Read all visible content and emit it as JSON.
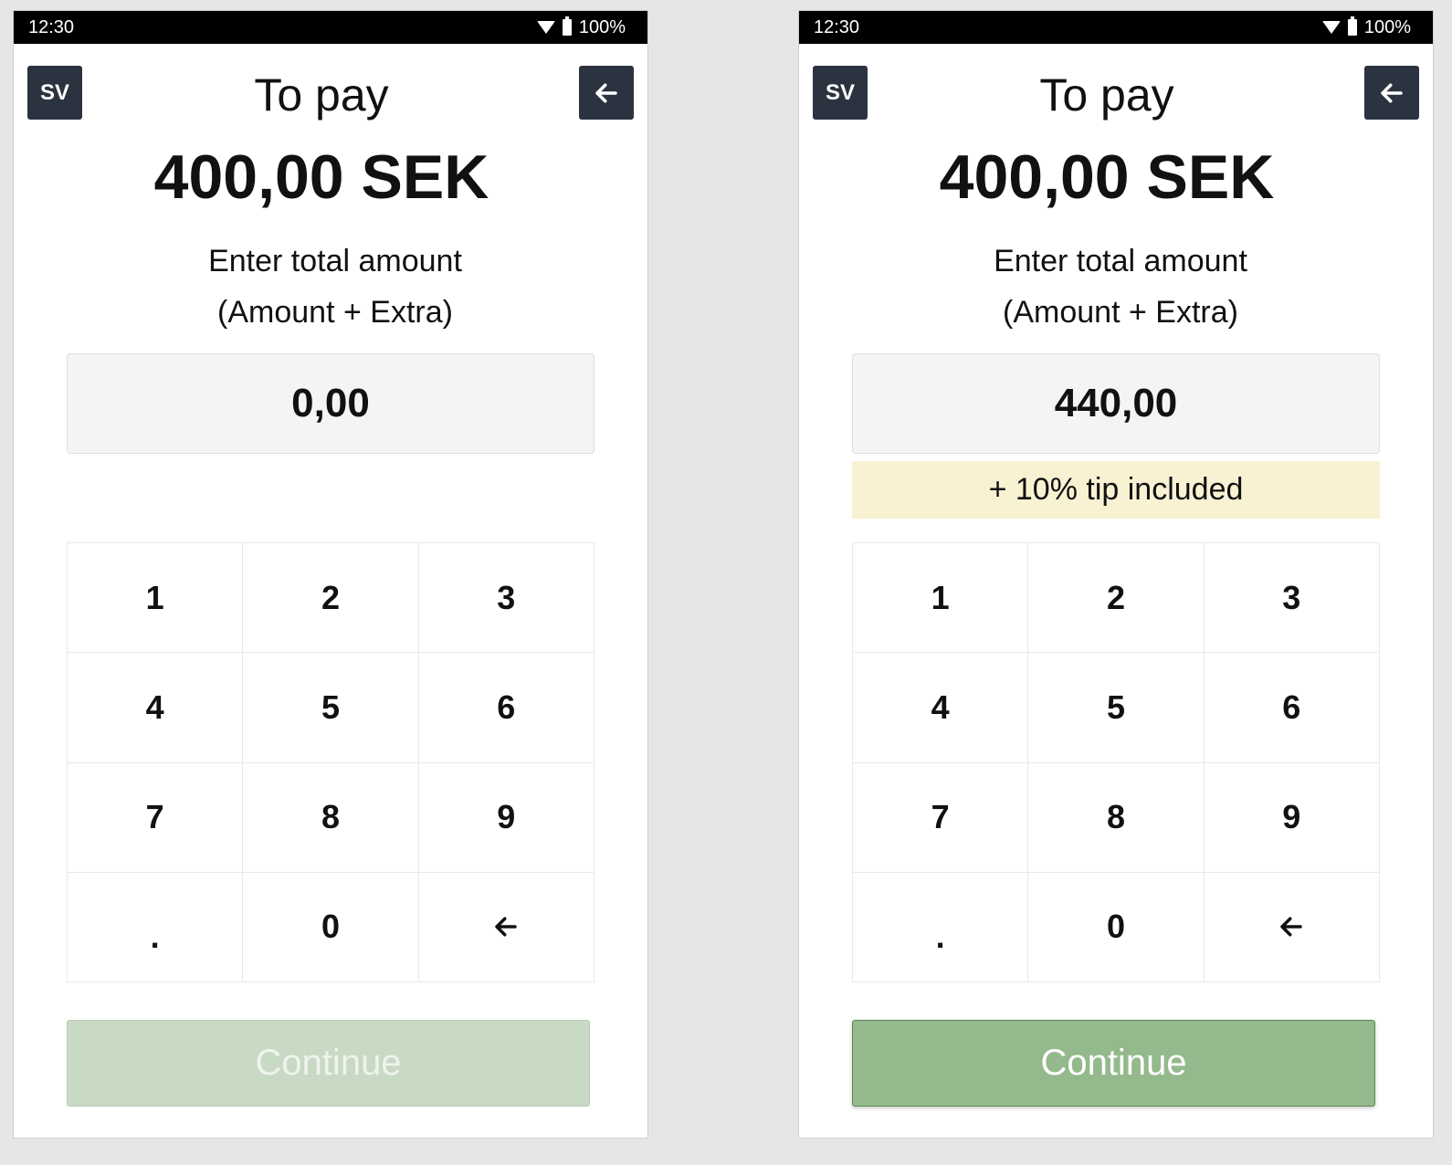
{
  "screens": [
    {
      "status": {
        "time": "12:30",
        "battery": "100%"
      },
      "language_label": "SV",
      "title": "To pay",
      "amount_due": "400,00 SEK",
      "instruction_line1": "Enter total amount",
      "instruction_line2": "(Amount + Extra)",
      "entered_amount": "0,00",
      "tip_note": "",
      "keys": [
        "1",
        "2",
        "3",
        "4",
        "5",
        "6",
        "7",
        "8",
        "9",
        ".",
        "0"
      ],
      "continue_label": "Continue",
      "continue_enabled": false
    },
    {
      "status": {
        "time": "12:30",
        "battery": "100%"
      },
      "language_label": "SV",
      "title": "To pay",
      "amount_due": "400,00 SEK",
      "instruction_line1": "Enter total amount",
      "instruction_line2": "(Amount + Extra)",
      "entered_amount": "440,00",
      "tip_note": "+ 10% tip included",
      "keys": [
        "1",
        "2",
        "3",
        "4",
        "5",
        "6",
        "7",
        "8",
        "9",
        ".",
        "0"
      ],
      "continue_label": "Continue",
      "continue_enabled": true
    }
  ],
  "icons": {
    "back": "arrow-left-icon",
    "keypad_backspace": "arrow-left-icon",
    "wifi": "wifi-icon",
    "battery": "battery-icon"
  },
  "colors": {
    "dark_button": "#2b3240",
    "tip_banner": "#f8f2d2",
    "continue_enabled": "#94b98c",
    "continue_disabled": "#c8d9c4"
  }
}
